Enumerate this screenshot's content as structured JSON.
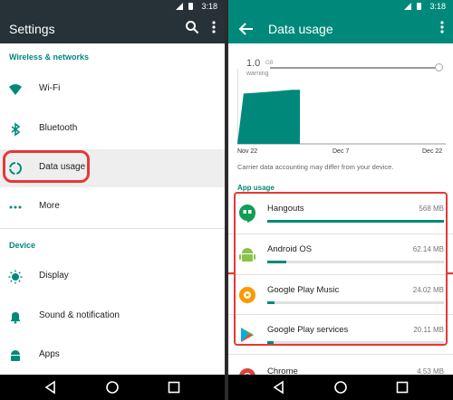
{
  "status": {
    "time": "3:18"
  },
  "settings": {
    "title": "Settings",
    "sections": [
      {
        "label": "Wireless & networks"
      },
      {
        "label": "Device"
      }
    ],
    "items": [
      {
        "label": "Wi-Fi",
        "icon": "wifi-icon"
      },
      {
        "label": "Bluetooth",
        "icon": "bluetooth-icon"
      },
      {
        "label": "Data usage",
        "icon": "data-usage-icon"
      },
      {
        "label": "More",
        "icon": "more-dots-icon"
      },
      {
        "label": "Display",
        "icon": "display-icon"
      },
      {
        "label": "Sound & notification",
        "icon": "bell-icon"
      },
      {
        "label": "Apps",
        "icon": "android-icon"
      }
    ]
  },
  "data_usage": {
    "title": "Data usage",
    "limit_value": "1.0",
    "limit_unit": "GB",
    "warning_label": "warning",
    "note": "Carrier data accounting may differ from your device.",
    "app_usage_label": "App usage",
    "chart_data": {
      "type": "area",
      "x": [
        "Nov 22",
        "Dec 7",
        "Dec 22"
      ],
      "x_ticks": [
        "Nov 22",
        "Dec 7",
        "Dec 22"
      ],
      "series": [
        {
          "x_fraction": [
            0.0,
            0.03,
            0.08,
            0.13,
            0.18,
            0.22,
            0.26,
            0.3
          ],
          "y_fraction": [
            0.0,
            0.67,
            0.68,
            0.69,
            0.7,
            0.71,
            0.72,
            0.72
          ]
        }
      ],
      "ylim": [
        0,
        1.0
      ],
      "grid": false,
      "colors": [
        "#00897b"
      ]
    },
    "apps": [
      {
        "name": "Hangouts",
        "size": "568 MB",
        "usage_fraction": 1.0,
        "icon": "hangouts-icon"
      },
      {
        "name": "Android OS",
        "size": "62.14 MB",
        "usage_fraction": 0.11,
        "icon": "android-os-icon"
      },
      {
        "name": "Google Play Music",
        "size": "24.02 MB",
        "usage_fraction": 0.042,
        "icon": "play-music-icon"
      },
      {
        "name": "Google Play services",
        "size": "20.11 MB",
        "usage_fraction": 0.035,
        "icon": "play-services-icon"
      },
      {
        "name": "Chrome",
        "size": "4.53 MB",
        "usage_fraction": 0.01,
        "icon": "chrome-icon"
      }
    ]
  },
  "colors": {
    "accent": "#00897b",
    "highlight": "#e53935",
    "settings_bar": "#263238"
  }
}
